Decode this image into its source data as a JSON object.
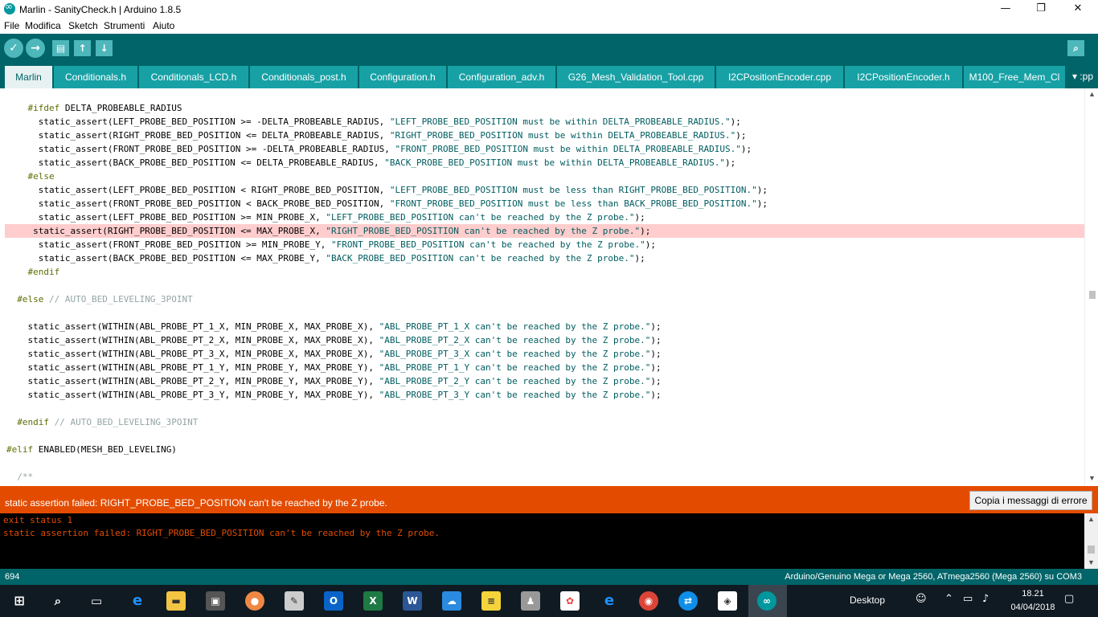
{
  "window": {
    "title": "Marlin - SanityCheck.h | Arduino 1.8.5",
    "minimize": "—",
    "maximize": "❐",
    "close": "✕"
  },
  "menu": [
    "File",
    "Modifica",
    "Sketch",
    "Strumenti",
    "Aiuto"
  ],
  "toolbar": {
    "verify_icon": "check-icon",
    "upload_icon": "arrow-right-icon",
    "new_icon": "new-file-icon",
    "open_icon": "open-icon",
    "save_icon": "save-icon",
    "monitor_icon": "serial-monitor-icon"
  },
  "tabs": [
    {
      "label": "Marlin"
    },
    {
      "label": "Conditionals.h"
    },
    {
      "label": "Conditionals_LCD.h"
    },
    {
      "label": "Conditionals_post.h"
    },
    {
      "label": "Configuration.h"
    },
    {
      "label": "Configuration_adv.h"
    },
    {
      "label": "G26_Mesh_Validation_Tool.cpp"
    },
    {
      "label": "I2CPositionEncoder.cpp"
    },
    {
      "label": "I2CPositionEncoder.h"
    },
    {
      "label": "M100_Free_Mem_Cl"
    }
  ],
  "tab_menu": "▾ :pp",
  "code": [
    {
      "t": [
        {
          "c": "kw",
          "s": "    #ifdef"
        },
        {
          "s": " DELTA_PROBEABLE_RADIUS"
        }
      ]
    },
    {
      "t": [
        {
          "s": "      static_assert(LEFT_PROBE_BED_POSITION >= -DELTA_PROBEABLE_RADIUS, "
        },
        {
          "c": "str",
          "s": "\"LEFT_PROBE_BED_POSITION must be within DELTA_PROBEABLE_RADIUS.\""
        },
        {
          "s": ");"
        }
      ]
    },
    {
      "t": [
        {
          "s": "      static_assert(RIGHT_PROBE_BED_POSITION <= DELTA_PROBEABLE_RADIUS, "
        },
        {
          "c": "str",
          "s": "\"RIGHT_PROBE_BED_POSITION must be within DELTA_PROBEABLE_RADIUS.\""
        },
        {
          "s": ");"
        }
      ]
    },
    {
      "t": [
        {
          "s": "      static_assert(FRONT_PROBE_BED_POSITION >= -DELTA_PROBEABLE_RADIUS, "
        },
        {
          "c": "str",
          "s": "\"FRONT_PROBE_BED_POSITION must be within DELTA_PROBEABLE_RADIUS.\""
        },
        {
          "s": ");"
        }
      ]
    },
    {
      "t": [
        {
          "s": "      static_assert(BACK_PROBE_BED_POSITION <= DELTA_PROBEABLE_RADIUS, "
        },
        {
          "c": "str",
          "s": "\"BACK_PROBE_BED_POSITION must be within DELTA_PROBEABLE_RADIUS.\""
        },
        {
          "s": ");"
        }
      ]
    },
    {
      "t": [
        {
          "c": "kw",
          "s": "    #else"
        }
      ]
    },
    {
      "t": [
        {
          "s": "      static_assert(LEFT_PROBE_BED_POSITION < RIGHT_PROBE_BED_POSITION, "
        },
        {
          "c": "str",
          "s": "\"LEFT_PROBE_BED_POSITION must be less than RIGHT_PROBE_BED_POSITION.\""
        },
        {
          "s": ");"
        }
      ]
    },
    {
      "t": [
        {
          "s": "      static_assert(FRONT_PROBE_BED_POSITION < BACK_PROBE_BED_POSITION, "
        },
        {
          "c": "str",
          "s": "\"FRONT_PROBE_BED_POSITION must be less than BACK_PROBE_BED_POSITION.\""
        },
        {
          "s": ");"
        }
      ]
    },
    {
      "t": [
        {
          "s": "      static_assert(LEFT_PROBE_BED_POSITION >= MIN_PROBE_X, "
        },
        {
          "c": "str",
          "s": "\"LEFT_PROBE_BED_POSITION can't be reached by the Z probe.\""
        },
        {
          "s": ");"
        }
      ]
    },
    {
      "hl": true,
      "t": [
        {
          "s": "     static_assert(RIGHT_PROBE_BED_POSITION <= MAX_PROBE_X, "
        },
        {
          "c": "str",
          "s": "\"RIGHT_PROBE_BED_POSITION can't be reached by the Z probe.\""
        },
        {
          "s": ");"
        }
      ]
    },
    {
      "t": [
        {
          "s": "      static_assert(FRONT_PROBE_BED_POSITION >= MIN_PROBE_Y, "
        },
        {
          "c": "str",
          "s": "\"FRONT_PROBE_BED_POSITION can't be reached by the Z probe.\""
        },
        {
          "s": ");"
        }
      ]
    },
    {
      "t": [
        {
          "s": "      static_assert(BACK_PROBE_BED_POSITION <= MAX_PROBE_Y, "
        },
        {
          "c": "str",
          "s": "\"BACK_PROBE_BED_POSITION can't be reached by the Z probe.\""
        },
        {
          "s": ");"
        }
      ]
    },
    {
      "t": [
        {
          "c": "kw",
          "s": "    #endif"
        }
      ]
    },
    {
      "t": []
    },
    {
      "t": [
        {
          "c": "kw",
          "s": "  #else"
        },
        {
          "c": "cm",
          "s": " // AUTO_BED_LEVELING_3POINT"
        }
      ]
    },
    {
      "t": []
    },
    {
      "t": [
        {
          "s": "    static_assert(WITHIN(ABL_PROBE_PT_1_X, MIN_PROBE_X, MAX_PROBE_X), "
        },
        {
          "c": "str",
          "s": "\"ABL_PROBE_PT_1_X can't be reached by the Z probe.\""
        },
        {
          "s": ");"
        }
      ]
    },
    {
      "t": [
        {
          "s": "    static_assert(WITHIN(ABL_PROBE_PT_2_X, MIN_PROBE_X, MAX_PROBE_X), "
        },
        {
          "c": "str",
          "s": "\"ABL_PROBE_PT_2_X can't be reached by the Z probe.\""
        },
        {
          "s": ");"
        }
      ]
    },
    {
      "t": [
        {
          "s": "    static_assert(WITHIN(ABL_PROBE_PT_3_X, MIN_PROBE_X, MAX_PROBE_X), "
        },
        {
          "c": "str",
          "s": "\"ABL_PROBE_PT_3_X can't be reached by the Z probe.\""
        },
        {
          "s": ");"
        }
      ]
    },
    {
      "t": [
        {
          "s": "    static_assert(WITHIN(ABL_PROBE_PT_1_Y, MIN_PROBE_Y, MAX_PROBE_Y), "
        },
        {
          "c": "str",
          "s": "\"ABL_PROBE_PT_1_Y can't be reached by the Z probe.\""
        },
        {
          "s": ");"
        }
      ]
    },
    {
      "t": [
        {
          "s": "    static_assert(WITHIN(ABL_PROBE_PT_2_Y, MIN_PROBE_Y, MAX_PROBE_Y), "
        },
        {
          "c": "str",
          "s": "\"ABL_PROBE_PT_2_Y can't be reached by the Z probe.\""
        },
        {
          "s": ");"
        }
      ]
    },
    {
      "t": [
        {
          "s": "    static_assert(WITHIN(ABL_PROBE_PT_3_Y, MIN_PROBE_Y, MAX_PROBE_Y), "
        },
        {
          "c": "str",
          "s": "\"ABL_PROBE_PT_3_Y can't be reached by the Z probe.\""
        },
        {
          "s": ");"
        }
      ]
    },
    {
      "t": []
    },
    {
      "t": [
        {
          "c": "kw",
          "s": "  #endif"
        },
        {
          "c": "cm",
          "s": " // AUTO_BED_LEVELING_3POINT"
        }
      ]
    },
    {
      "t": []
    },
    {
      "t": [
        {
          "c": "kw",
          "s": "#elif"
        },
        {
          "s": " ENABLED(MESH_BED_LEVELING)"
        }
      ]
    },
    {
      "t": []
    },
    {
      "t": [
        {
          "c": "cm",
          "s": "  /**"
        }
      ]
    }
  ],
  "error": {
    "message": "static assertion failed: RIGHT_PROBE_BED_POSITION can't be reached by the Z probe.",
    "copy_button": "Copia i messaggi di errore"
  },
  "console": [
    "exit status 1",
    "static assertion failed: RIGHT_PROBE_BED_POSITION can't be reached by the Z probe."
  ],
  "status": {
    "line_number": "694",
    "board": "Arduino/Genuino Mega or Mega 2560, ATmega2560 (Mega 2560) su COM3"
  },
  "taskbar": {
    "desktop_label": "Desktop",
    "time": "18.21",
    "date": "04/04/2018"
  },
  "colors": {
    "toolbar": "#006468",
    "tab": "#17a1a5",
    "error_bar": "#e34c00",
    "highlight_line": "#ffcdcd"
  }
}
